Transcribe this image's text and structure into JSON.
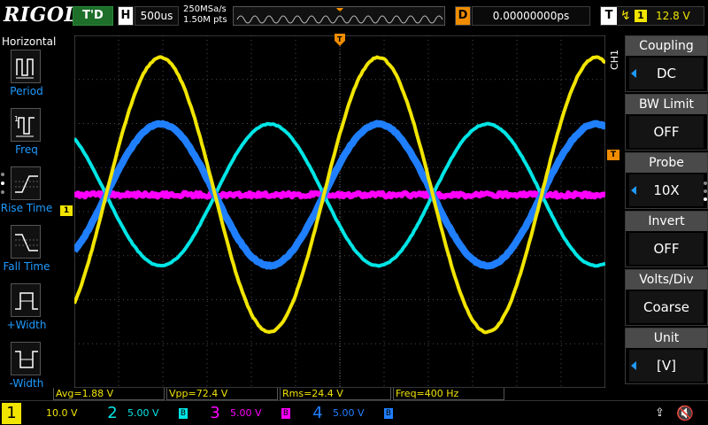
{
  "header": {
    "brand": "RIGOL",
    "trigger_status": "T'D",
    "horizontal_badge": "H",
    "timebase": "500us",
    "sample_rate": "250MSa/s",
    "memory_depth": "1.50M pts",
    "delay_badge": "D",
    "delay_value": "0.00000000ps",
    "trigger_badge": "T",
    "trigger_edge_icon": "rising-edge-icon",
    "trigger_source": "1",
    "trigger_level": "12.8 V"
  },
  "left_panel": {
    "title": "Horizontal",
    "items": [
      {
        "label": "Period",
        "icon": "period-icon"
      },
      {
        "label": "Freq",
        "icon": "frequency-icon"
      },
      {
        "label": "Rise Time",
        "icon": "rise-time-icon"
      },
      {
        "label": "Fall Time",
        "icon": "fall-time-icon"
      },
      {
        "label": "+Width",
        "icon": "positive-width-icon"
      },
      {
        "label": "-Width",
        "icon": "negative-width-icon"
      }
    ]
  },
  "markers": {
    "ch1_ground": "1",
    "trigger_position": "T",
    "trigger_level": "T"
  },
  "right_menu": {
    "channel_tag": "CH1",
    "items": [
      {
        "title": "Coupling",
        "value": "DC",
        "has_arrow": true
      },
      {
        "title": "BW Limit",
        "value": "OFF",
        "has_arrow": false
      },
      {
        "title": "Probe",
        "value": "10X",
        "has_arrow": true
      },
      {
        "title": "Invert",
        "value": "OFF",
        "has_arrow": false
      },
      {
        "title": "Volts/Div",
        "value": "Coarse",
        "has_arrow": false
      },
      {
        "title": "Unit",
        "value": "[V]",
        "has_arrow": true
      }
    ]
  },
  "measurements": [
    {
      "text": "Avg=1.88 V"
    },
    {
      "text": "Vpp=72.4 V"
    },
    {
      "text": "Rms=24.4 V"
    },
    {
      "text": "Freq=400 Hz"
    }
  ],
  "channels": [
    {
      "num": "1",
      "scale": "10.0 V",
      "color": "#f1e500"
    },
    {
      "num": "2",
      "scale": "5.00 V",
      "color": "#00e5e5"
    },
    {
      "num": "3",
      "scale": "5.00 V",
      "color": "#ff00ff"
    },
    {
      "num": "4",
      "scale": "5.00 V",
      "color": "#1f7fff"
    }
  ],
  "colors": {
    "ch1": "#f1e500",
    "ch2": "#00e5e5",
    "ch3": "#ff00ff",
    "ch4": "#1f7fff",
    "trigger": "#f08c00",
    "menu_accent": "#1f9bff"
  }
}
